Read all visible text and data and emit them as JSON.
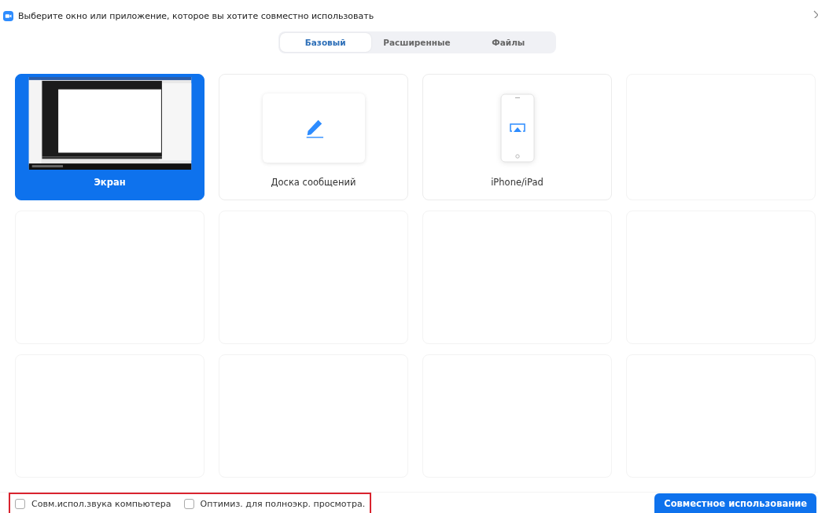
{
  "window": {
    "title": "Выберите окно или приложение, которое вы хотите совместно использовать"
  },
  "tabs": [
    {
      "label": "Базовый",
      "selected": true
    },
    {
      "label": "Расширенные",
      "selected": false
    },
    {
      "label": "Файлы",
      "selected": false
    }
  ],
  "share_options": [
    {
      "kind": "screen",
      "label": "Экран",
      "selected": true
    },
    {
      "kind": "whiteboard",
      "label": "Доска сообщений",
      "selected": false
    },
    {
      "kind": "iphone",
      "label": "iPhone/iPad",
      "selected": false
    }
  ],
  "checkboxes": [
    {
      "label": "Совм.испол.звука компьютера",
      "checked": false
    },
    {
      "label": "Оптимиз. для полноэкр. просмотра.",
      "checked": false
    }
  ],
  "share_button": "Совместное использование"
}
